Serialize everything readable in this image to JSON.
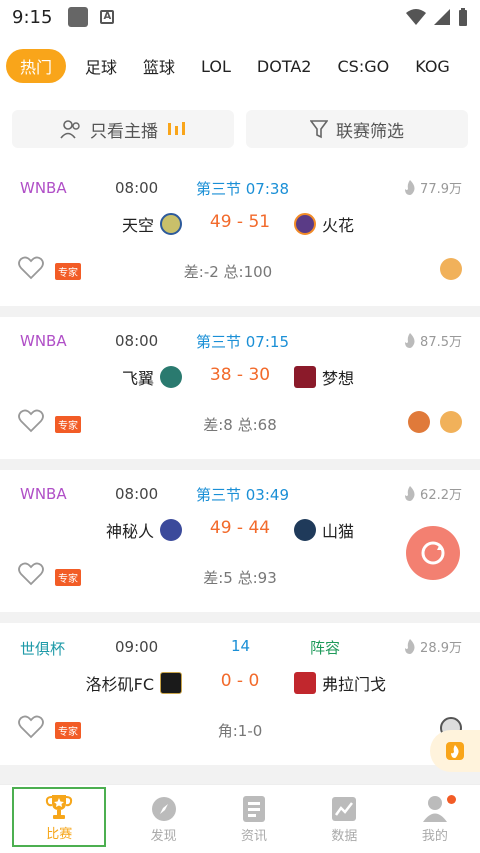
{
  "statusbar": {
    "time": "9:15"
  },
  "tabs": [
    "热门",
    "足球",
    "篮球",
    "LOL",
    "DOTA2",
    "CS:GO",
    "KOG"
  ],
  "filters": {
    "only_host": "只看主播",
    "league_filter": "联赛筛选"
  },
  "matches": [
    {
      "league": "WNBA",
      "time": "08:00",
      "status": "第三节 07:38",
      "aux": "",
      "heat": "77.9万",
      "home": "天空",
      "home_score": "49",
      "score_sep": "-",
      "away_score": "51",
      "away": "火花",
      "badge": "专家",
      "stats": "差:-2 总:100"
    },
    {
      "league": "WNBA",
      "time": "08:00",
      "status": "第三节 07:15",
      "aux": "",
      "heat": "87.5万",
      "home": "飞翼",
      "home_score": "38",
      "score_sep": "-",
      "away_score": "30",
      "away": "梦想",
      "badge": "专家",
      "stats": "差:8 总:68"
    },
    {
      "league": "WNBA",
      "time": "08:00",
      "status": "第三节 03:49",
      "aux": "",
      "heat": "62.2万",
      "home": "神秘人",
      "home_score": "49",
      "score_sep": "-",
      "away_score": "44",
      "away": "山猫",
      "badge": "专家",
      "stats": "差:5 总:93"
    },
    {
      "league": "世俱杯",
      "time": "09:00",
      "status": "14",
      "aux": "阵容",
      "heat": "28.9万",
      "home": "洛杉矶FC",
      "home_score": "0",
      "score_sep": "-",
      "away_score": "0",
      "away": "弗拉门戈",
      "badge": "专家",
      "stats": "角:1-0"
    }
  ],
  "bottomnav": [
    {
      "label": "比赛",
      "icon": "trophy-icon"
    },
    {
      "label": "发现",
      "icon": "compass-icon"
    },
    {
      "label": "资讯",
      "icon": "news-icon"
    },
    {
      "label": "数据",
      "icon": "chart-icon"
    },
    {
      "label": "我的",
      "icon": "user-icon"
    }
  ],
  "colors": {
    "accent": "#f9a51a",
    "score": "#f26a2b",
    "status": "#1a8fd6",
    "league": "#b04fc7",
    "badge": "#f25c26",
    "nav_highlight": "#4caf50"
  }
}
